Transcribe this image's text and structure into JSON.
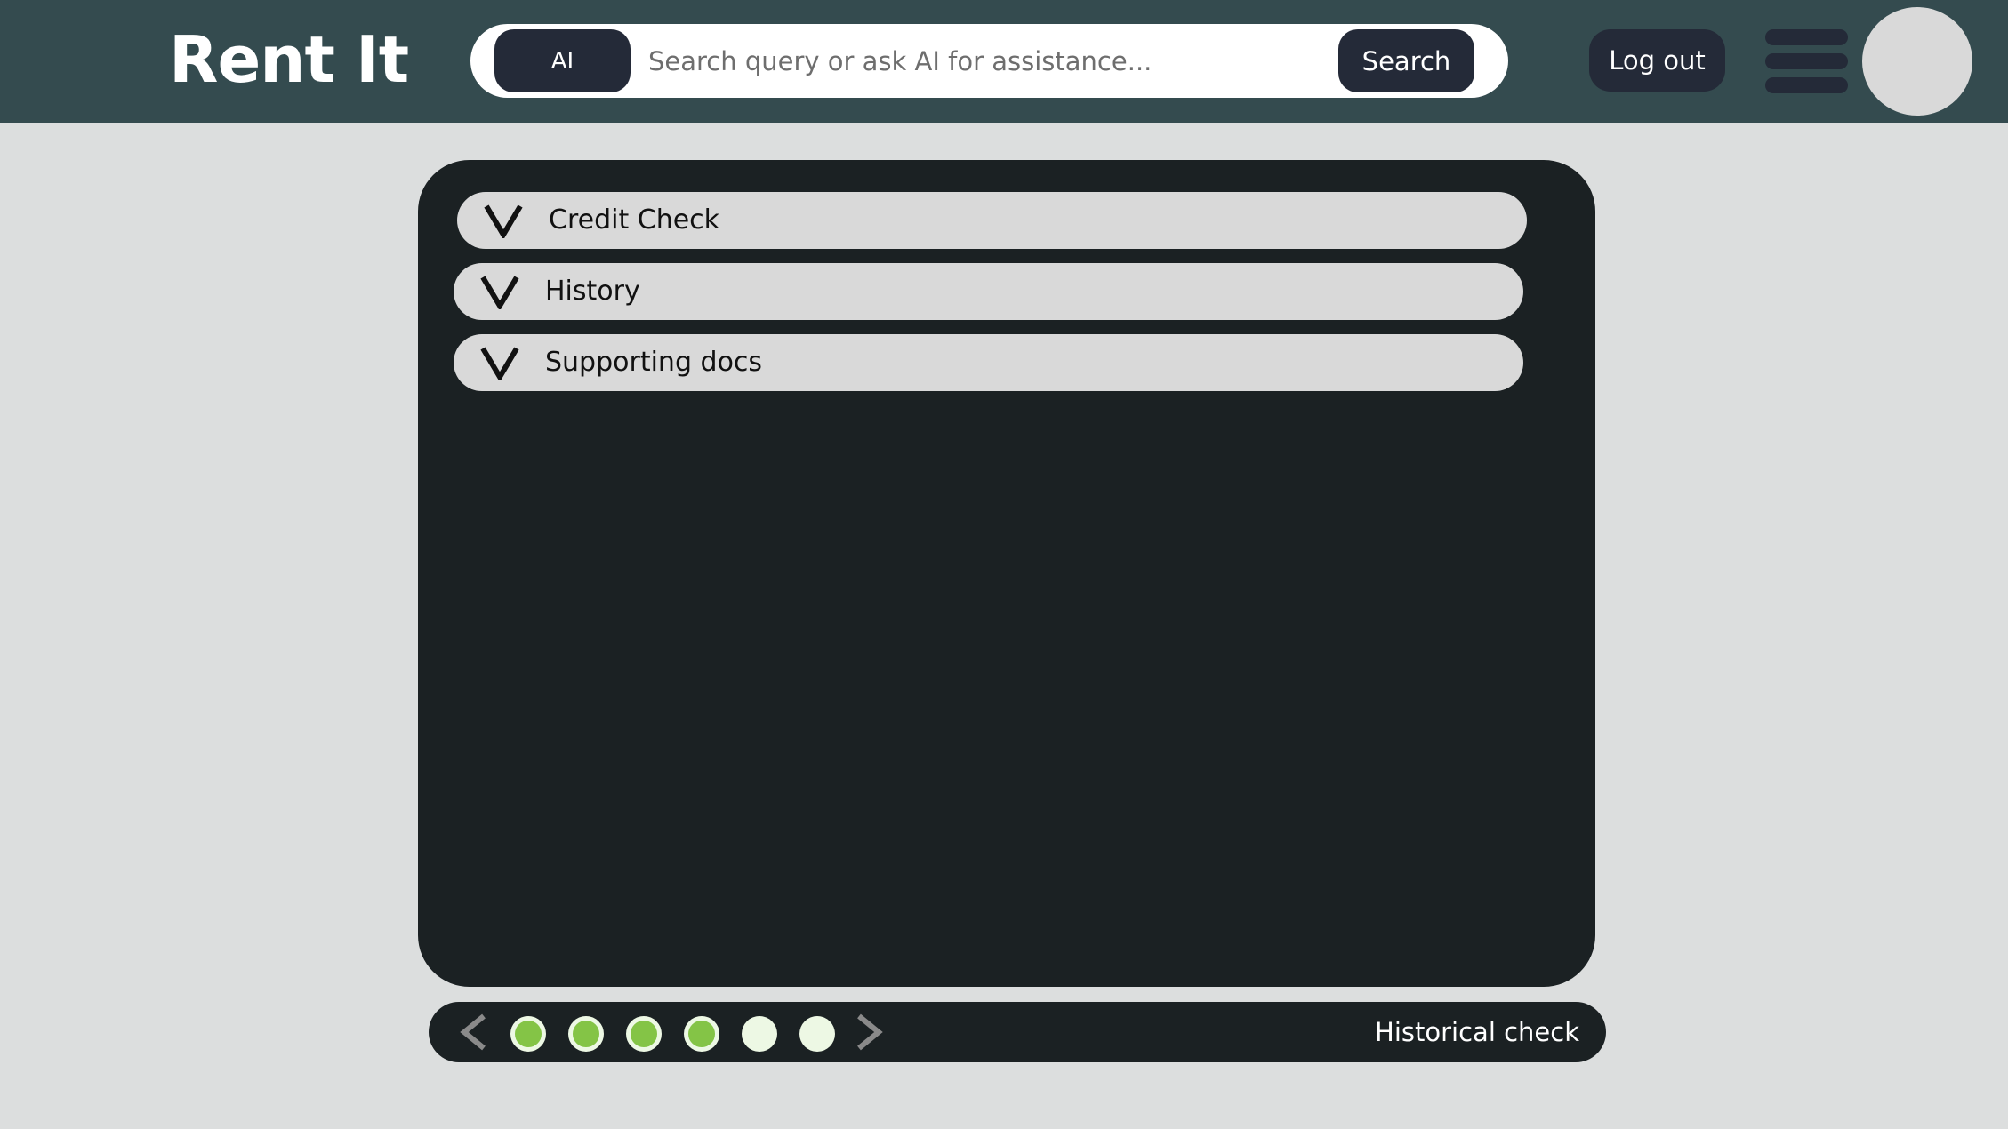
{
  "header": {
    "brand": "Rent It",
    "search": {
      "mode_label": "AI",
      "placeholder": "Search query or ask AI for assistance...",
      "value": "",
      "button_label": "Search"
    },
    "logout_label": "Log out"
  },
  "accordion": {
    "items": [
      {
        "label": "Credit Check",
        "expanded": false
      },
      {
        "label": "History",
        "expanded": false
      },
      {
        "label": "Supporting docs",
        "expanded": false
      }
    ]
  },
  "progress": {
    "total_steps": 6,
    "completed_steps": 4,
    "current_step_label": "Historical check"
  },
  "colors": {
    "header_bg": "#344b4f",
    "page_bg": "#dcdede",
    "panel_bg": "#1b2123",
    "button_bg": "#242a38",
    "step_done": "#84c446",
    "step_pending": "#edf8e4"
  }
}
